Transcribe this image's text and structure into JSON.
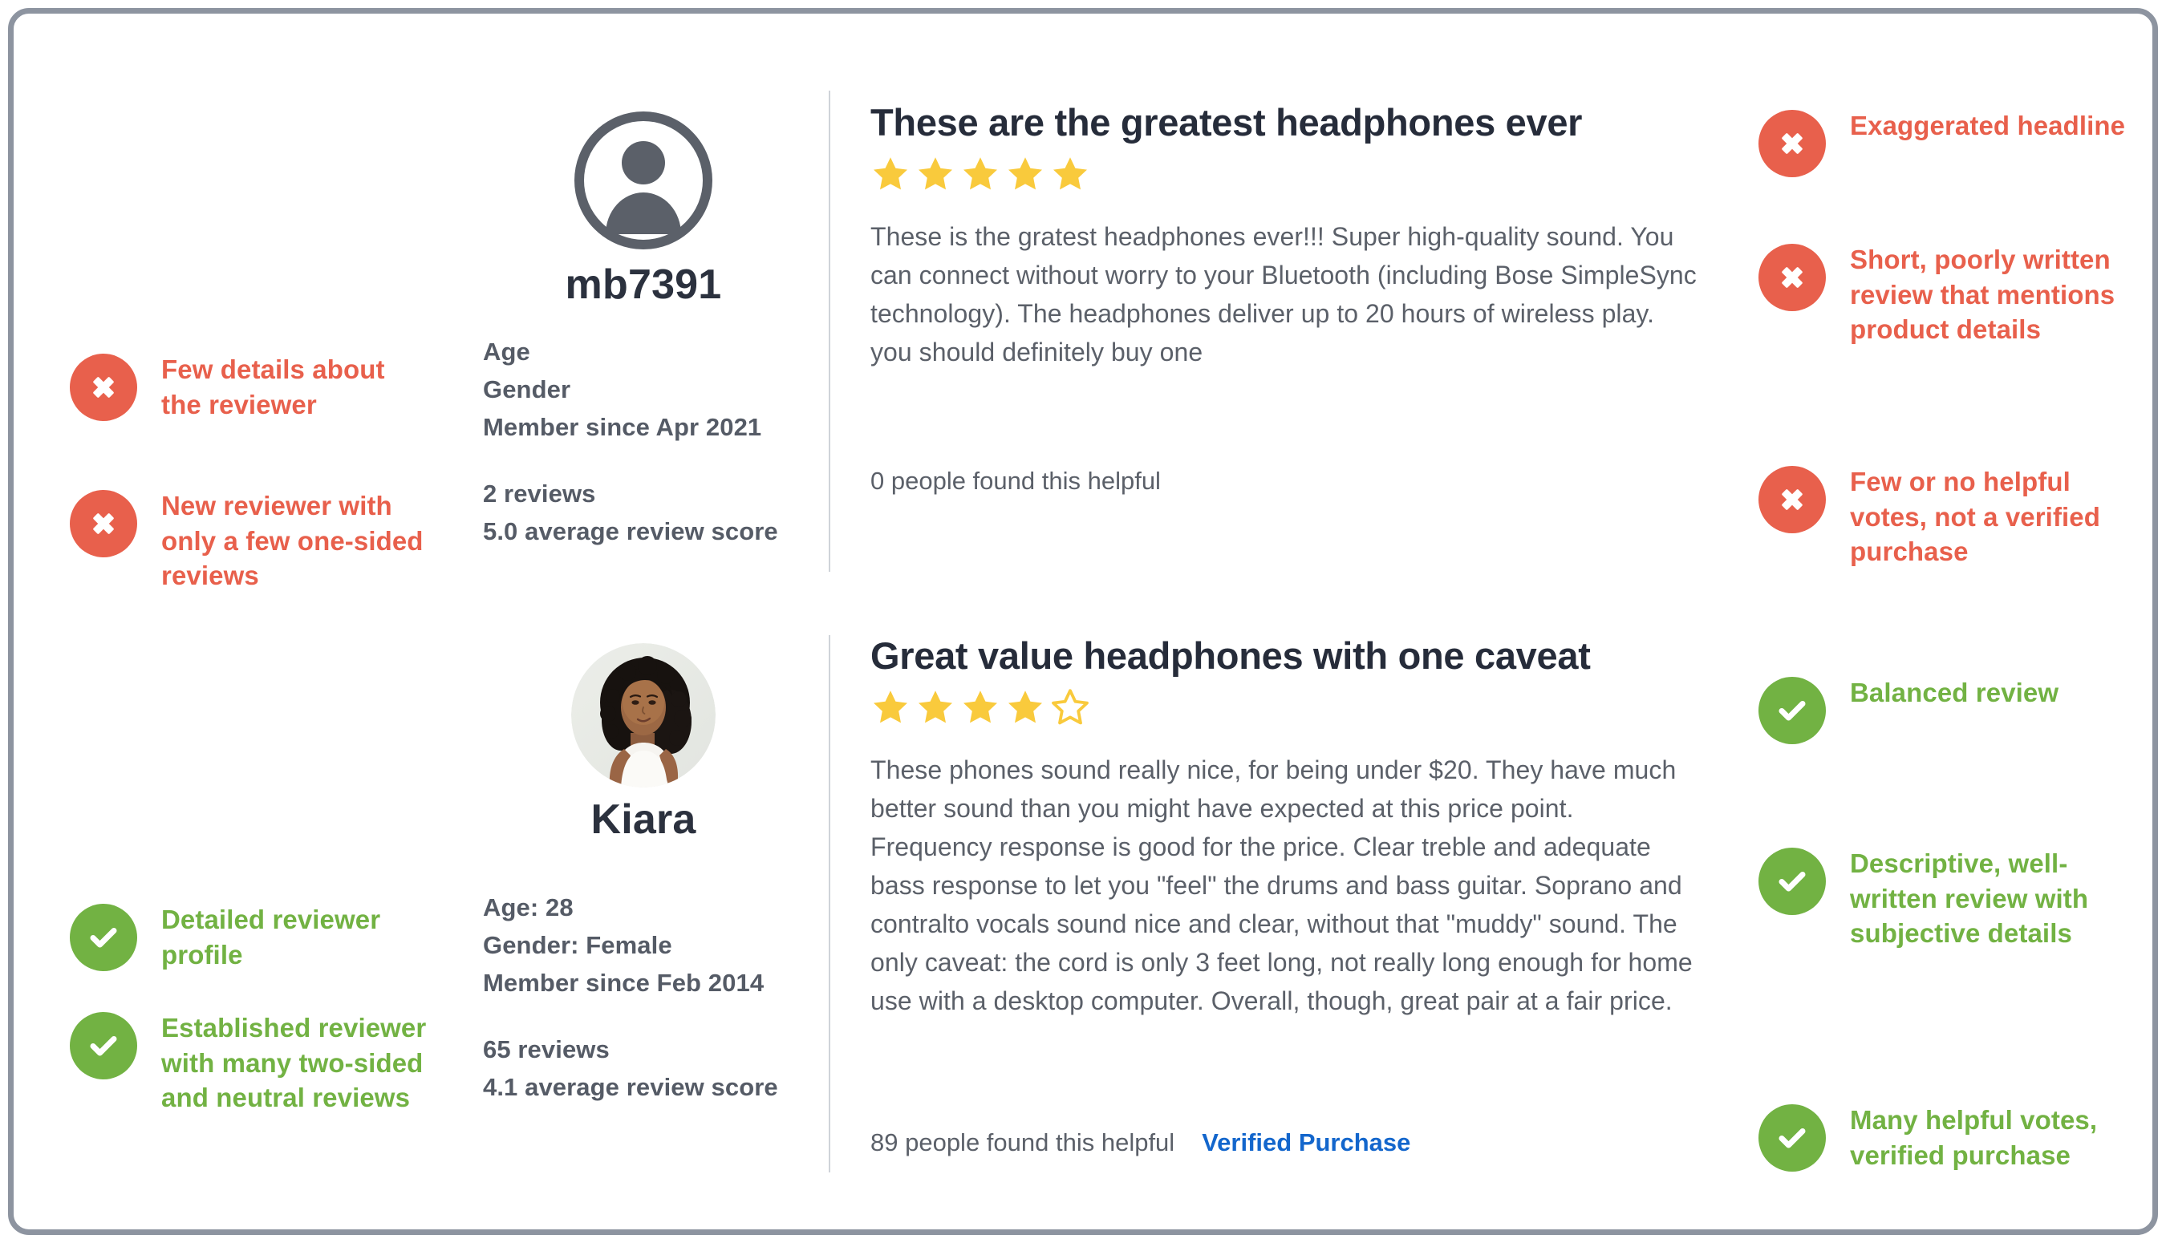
{
  "colors": {
    "negative": "#e8604c",
    "positive": "#72b243",
    "star": "#f9ca3c",
    "link": "#1366cc",
    "text": "#5b6069",
    "heading": "#262c3a",
    "border": "#8d94a0"
  },
  "reviews": [
    {
      "reviewer": {
        "name": "mb7391",
        "avatar": "default-user-avatar-icon",
        "age": "Age",
        "gender": "Gender",
        "member_since": "Member since Apr 2021",
        "review_count": "2 reviews",
        "average_score": "5.0 average review score"
      },
      "title": "These are the greatest headphones ever",
      "rating": 5,
      "max_rating": 5,
      "body": "These is the gratest headphones ever!!! Super high-quality sound. You can connect without worry to your Bluetooth (including Bose SimpleSync technology). The headphones deliver up to 20 hours of wireless play. you should definitely buy one",
      "helpful": "0 people found this helpful",
      "verified_label": ""
    },
    {
      "reviewer": {
        "name": "Kiara",
        "avatar": "woman-portrait-photo",
        "age": "Age: 28",
        "gender": "Gender: Female",
        "member_since": "Member since Feb 2014",
        "review_count": "65 reviews",
        "average_score": "4.1 average review score"
      },
      "title": "Great value headphones with one caveat",
      "rating": 4,
      "max_rating": 5,
      "body": "These phones sound really nice, for being under $20. They have much better sound than you might have expected at this price point. Frequency response is good for the price. Clear treble and adequate bass response to let you \"feel\" the drums and bass guitar. Soprano and contralto vocals sound nice and clear, without that \"muddy\" sound.  The only caveat: the cord is only 3 feet long, not really long enough for home use with a desktop computer. Overall, though, great pair at a fair price.",
      "helpful": "89 people found this helpful",
      "verified_label": "Verified Purchase"
    }
  ],
  "annotations": {
    "left": [
      {
        "type": "negative",
        "icon": "x-circle-icon",
        "text": "Few details about the reviewer"
      },
      {
        "type": "negative",
        "icon": "x-circle-icon",
        "text": "New reviewer with only a few one-sided reviews"
      },
      {
        "type": "positive",
        "icon": "check-circle-icon",
        "text": "Detailed reviewer profile"
      },
      {
        "type": "positive",
        "icon": "check-circle-icon",
        "text": "Established reviewer with many two-sided and neutral reviews"
      }
    ],
    "right": [
      {
        "type": "negative",
        "icon": "x-circle-icon",
        "text": "Exaggerated headline"
      },
      {
        "type": "negative",
        "icon": "x-circle-icon",
        "text": "Short, poorly written review that mentions product details"
      },
      {
        "type": "negative",
        "icon": "x-circle-icon",
        "text": "Few or no helpful votes, not a verified purchase"
      },
      {
        "type": "positive",
        "icon": "check-circle-icon",
        "text": "Balanced review"
      },
      {
        "type": "positive",
        "icon": "check-circle-icon",
        "text": "Descriptive, well-written review with subjective details"
      },
      {
        "type": "positive",
        "icon": "check-circle-icon",
        "text": "Many helpful votes, verified purchase"
      }
    ]
  }
}
